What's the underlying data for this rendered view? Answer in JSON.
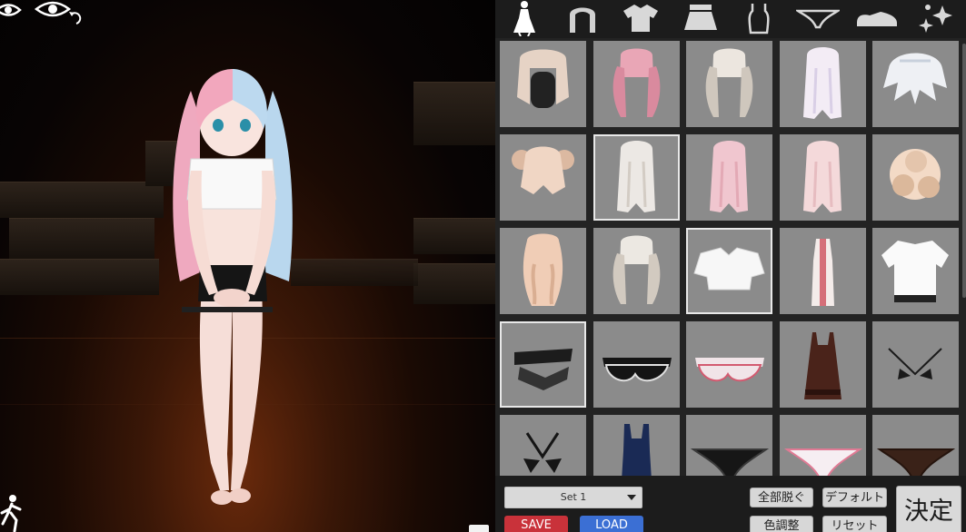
{
  "viewport": {
    "icons": [
      "eye-icon",
      "eye-rotate-icon",
      "walk-icon"
    ]
  },
  "categories": [
    {
      "name": "full-outfit-icon",
      "active": true
    },
    {
      "name": "hair-icon",
      "active": false
    },
    {
      "name": "top-shirt-icon",
      "active": false
    },
    {
      "name": "skirt-icon",
      "active": false
    },
    {
      "name": "camisole-icon",
      "active": false
    },
    {
      "name": "underwear-icon",
      "active": false
    },
    {
      "name": "shoes-icon",
      "active": false
    },
    {
      "name": "accessories-sparkle-icon",
      "active": false
    }
  ],
  "items": [
    {
      "kind": "hair",
      "variant": "bob",
      "colors": [
        "#e6d3c5",
        "#cdb8a8"
      ],
      "selected": false
    },
    {
      "kind": "hair",
      "variant": "twin",
      "colors": [
        "#e9a6b6",
        "#d98a9e"
      ],
      "selected": false
    },
    {
      "kind": "hair",
      "variant": "twin",
      "colors": [
        "#ece6df",
        "#cfc7bd"
      ],
      "selected": false
    },
    {
      "kind": "hair",
      "variant": "long",
      "colors": [
        "#f3ecf5",
        "#d9cfe6"
      ],
      "selected": false
    },
    {
      "kind": "hair",
      "variant": "messy",
      "colors": [
        "#eef0f4",
        "#c8d0dc"
      ],
      "selected": false
    },
    {
      "kind": "hair",
      "variant": "buns",
      "colors": [
        "#f0d6c4",
        "#dcb9a1"
      ],
      "selected": false
    },
    {
      "kind": "hair",
      "variant": "long",
      "colors": [
        "#ece8e4",
        "#d3ccc4"
      ],
      "selected": true
    },
    {
      "kind": "hair",
      "variant": "long",
      "colors": [
        "#f0c6cf",
        "#e3a9b5"
      ],
      "selected": false
    },
    {
      "kind": "hair",
      "variant": "long",
      "colors": [
        "#f4d9da",
        "#e6bcc0"
      ],
      "selected": false
    },
    {
      "kind": "hair",
      "variant": "curly",
      "colors": [
        "#f3dac6",
        "#dbb89b"
      ],
      "selected": false
    },
    {
      "kind": "hair",
      "variant": "wavy",
      "colors": [
        "#f0cdb6",
        "#d9ae92"
      ],
      "selected": false
    },
    {
      "kind": "hair",
      "variant": "twin",
      "colors": [
        "#ece8e2",
        "#d2cac0"
      ],
      "selected": false
    },
    {
      "kind": "crop-shirt",
      "variant": "",
      "colors": [
        "#f7f7f7",
        "#d6d6d6"
      ],
      "selected": true
    },
    {
      "kind": "halter-dress",
      "variant": "",
      "colors": [
        "#f4ecea",
        "#c83a48"
      ],
      "selected": false
    },
    {
      "kind": "tshirt",
      "variant": "",
      "colors": [
        "#fafafa",
        "#222222"
      ],
      "selected": false
    },
    {
      "kind": "garter",
      "variant": "",
      "colors": [
        "#1c1c1c",
        "#333333"
      ],
      "selected": true
    },
    {
      "kind": "bra",
      "variant": "",
      "colors": [
        "#141414",
        "#e0e0e0"
      ],
      "selected": false
    },
    {
      "kind": "bra",
      "variant": "",
      "colors": [
        "#f1e4e8",
        "#d35a70"
      ],
      "selected": false
    },
    {
      "kind": "slip-dress",
      "variant": "",
      "colors": [
        "#4a231a",
        "#2b120d"
      ],
      "selected": false
    },
    {
      "kind": "micro-bra",
      "variant": "",
      "colors": [
        "#1a1a1a",
        "#cccccc"
      ],
      "selected": false
    },
    {
      "kind": "bikini-top",
      "variant": "",
      "colors": [
        "#151515",
        "#444444"
      ],
      "selected": false
    },
    {
      "kind": "swimsuit",
      "variant": "",
      "colors": [
        "#1a2a55",
        "#0f1a38"
      ],
      "selected": false
    },
    {
      "kind": "panties",
      "variant": "",
      "colors": [
        "#161616",
        "#3a3a3a"
      ],
      "selected": false
    },
    {
      "kind": "panties",
      "variant": "",
      "colors": [
        "#f6eef2",
        "#e07a94"
      ],
      "selected": false
    },
    {
      "kind": "panties",
      "variant": "",
      "colors": [
        "#3a2218",
        "#25140d"
      ],
      "selected": false
    }
  ],
  "footer": {
    "set_label": "Set 1",
    "save_label": "SAVE",
    "load_label": "LOAD",
    "undress_all_label": "全部脱ぐ",
    "default_label": "デフォルト",
    "color_adjust_label": "色調整",
    "reset_label": "リセット",
    "decide_label": "決定"
  },
  "colors": {
    "panel_bg": "#1c1c1c",
    "tile_bg": "#8b8b8b",
    "save": "#c9323a",
    "load": "#3b6fd4"
  }
}
